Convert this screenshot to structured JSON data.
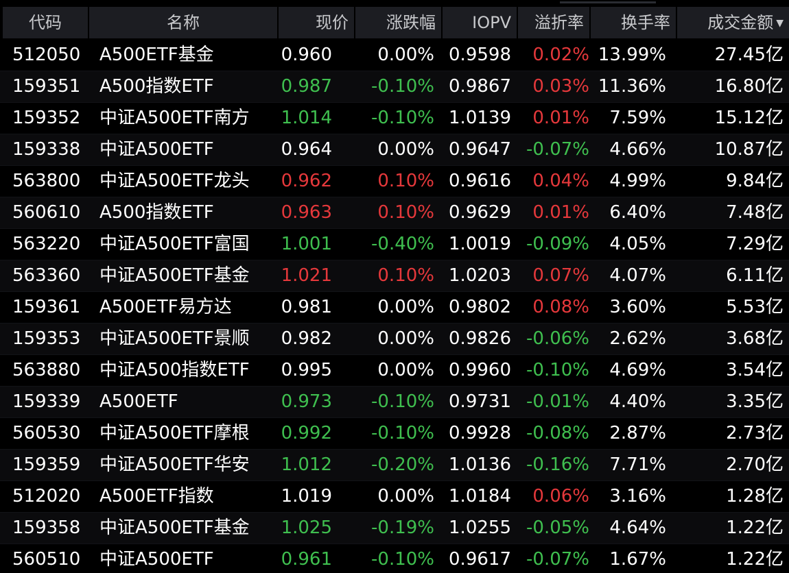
{
  "colors": {
    "up": "#e5383b",
    "down": "#3fbf4f",
    "flat": "#ffffff",
    "header_bg": "#1c1d22",
    "background": "#000000"
  },
  "header": {
    "code": "代码",
    "name": "名称",
    "price": "现价",
    "change": "涨跌幅",
    "iopv": "IOPV",
    "premium": "溢折率",
    "turnover": "换手率",
    "amount": "成交金额",
    "sort_icon": "sort-desc-icon",
    "sort_glyph": "▼"
  },
  "rows": [
    {
      "code": "512050",
      "name": "A500ETF基金",
      "price": "0.960",
      "price_dir": "flat",
      "change": "0.00%",
      "change_dir": "flat",
      "iopv": "0.9598",
      "premium": "0.02%",
      "premium_dir": "up",
      "turnover": "13.99%",
      "amount": "27.45亿"
    },
    {
      "code": "159351",
      "name": "A500指数ETF",
      "price": "0.987",
      "price_dir": "down",
      "change": "-0.10%",
      "change_dir": "down",
      "iopv": "0.9867",
      "premium": "0.03%",
      "premium_dir": "up",
      "turnover": "11.36%",
      "amount": "16.80亿"
    },
    {
      "code": "159352",
      "name": "中证A500ETF南方",
      "price": "1.014",
      "price_dir": "down",
      "change": "-0.10%",
      "change_dir": "down",
      "iopv": "1.0139",
      "premium": "0.01%",
      "premium_dir": "up",
      "turnover": "7.59%",
      "amount": "15.12亿"
    },
    {
      "code": "159338",
      "name": "中证A500ETF",
      "price": "0.964",
      "price_dir": "flat",
      "change": "0.00%",
      "change_dir": "flat",
      "iopv": "0.9647",
      "premium": "-0.07%",
      "premium_dir": "down",
      "turnover": "4.66%",
      "amount": "10.87亿"
    },
    {
      "code": "563800",
      "name": "中证A500ETF龙头",
      "price": "0.962",
      "price_dir": "up",
      "change": "0.10%",
      "change_dir": "up",
      "iopv": "0.9616",
      "premium": "0.04%",
      "premium_dir": "up",
      "turnover": "4.99%",
      "amount": "9.84亿"
    },
    {
      "code": "560610",
      "name": "A500指数ETF",
      "price": "0.963",
      "price_dir": "up",
      "change": "0.10%",
      "change_dir": "up",
      "iopv": "0.9629",
      "premium": "0.01%",
      "premium_dir": "up",
      "turnover": "6.40%",
      "amount": "7.48亿"
    },
    {
      "code": "563220",
      "name": "中证A500ETF富国",
      "price": "1.001",
      "price_dir": "down",
      "change": "-0.40%",
      "change_dir": "down",
      "iopv": "1.0019",
      "premium": "-0.09%",
      "premium_dir": "down",
      "turnover": "4.05%",
      "amount": "7.29亿"
    },
    {
      "code": "563360",
      "name": "中证A500ETF基金",
      "price": "1.021",
      "price_dir": "up",
      "change": "0.10%",
      "change_dir": "up",
      "iopv": "1.0203",
      "premium": "0.07%",
      "premium_dir": "up",
      "turnover": "4.07%",
      "amount": "6.11亿"
    },
    {
      "code": "159361",
      "name": "A500ETF易方达",
      "price": "0.981",
      "price_dir": "flat",
      "change": "0.00%",
      "change_dir": "flat",
      "iopv": "0.9802",
      "premium": "0.08%",
      "premium_dir": "up",
      "turnover": "3.60%",
      "amount": "5.53亿"
    },
    {
      "code": "159353",
      "name": "中证A500ETF景顺",
      "price": "0.982",
      "price_dir": "flat",
      "change": "0.00%",
      "change_dir": "flat",
      "iopv": "0.9826",
      "premium": "-0.06%",
      "premium_dir": "down",
      "turnover": "2.62%",
      "amount": "3.68亿"
    },
    {
      "code": "563880",
      "name": "中证A500指数ETF",
      "price": "0.995",
      "price_dir": "flat",
      "change": "0.00%",
      "change_dir": "flat",
      "iopv": "0.9960",
      "premium": "-0.10%",
      "premium_dir": "down",
      "turnover": "4.69%",
      "amount": "3.54亿"
    },
    {
      "code": "159339",
      "name": "A500ETF",
      "price": "0.973",
      "price_dir": "down",
      "change": "-0.10%",
      "change_dir": "down",
      "iopv": "0.9731",
      "premium": "-0.01%",
      "premium_dir": "down",
      "turnover": "4.40%",
      "amount": "3.35亿"
    },
    {
      "code": "560530",
      "name": "中证A500ETF摩根",
      "price": "0.992",
      "price_dir": "down",
      "change": "-0.10%",
      "change_dir": "down",
      "iopv": "0.9928",
      "premium": "-0.08%",
      "premium_dir": "down",
      "turnover": "2.87%",
      "amount": "2.73亿"
    },
    {
      "code": "159359",
      "name": "中证A500ETF华安",
      "price": "1.012",
      "price_dir": "down",
      "change": "-0.20%",
      "change_dir": "down",
      "iopv": "1.0136",
      "premium": "-0.16%",
      "premium_dir": "down",
      "turnover": "7.71%",
      "amount": "2.70亿"
    },
    {
      "code": "512020",
      "name": "A500ETF指数",
      "price": "1.019",
      "price_dir": "flat",
      "change": "0.00%",
      "change_dir": "flat",
      "iopv": "1.0184",
      "premium": "0.06%",
      "premium_dir": "up",
      "turnover": "3.16%",
      "amount": "1.28亿"
    },
    {
      "code": "159358",
      "name": "中证A500ETF基金",
      "price": "1.025",
      "price_dir": "down",
      "change": "-0.19%",
      "change_dir": "down",
      "iopv": "1.0255",
      "premium": "-0.05%",
      "premium_dir": "down",
      "turnover": "4.64%",
      "amount": "1.22亿"
    },
    {
      "code": "560510",
      "name": "中证A500ETF",
      "price": "0.961",
      "price_dir": "down",
      "change": "-0.10%",
      "change_dir": "down",
      "iopv": "0.9617",
      "premium": "-0.07%",
      "premium_dir": "down",
      "turnover": "1.67%",
      "amount": "1.22亿"
    }
  ]
}
